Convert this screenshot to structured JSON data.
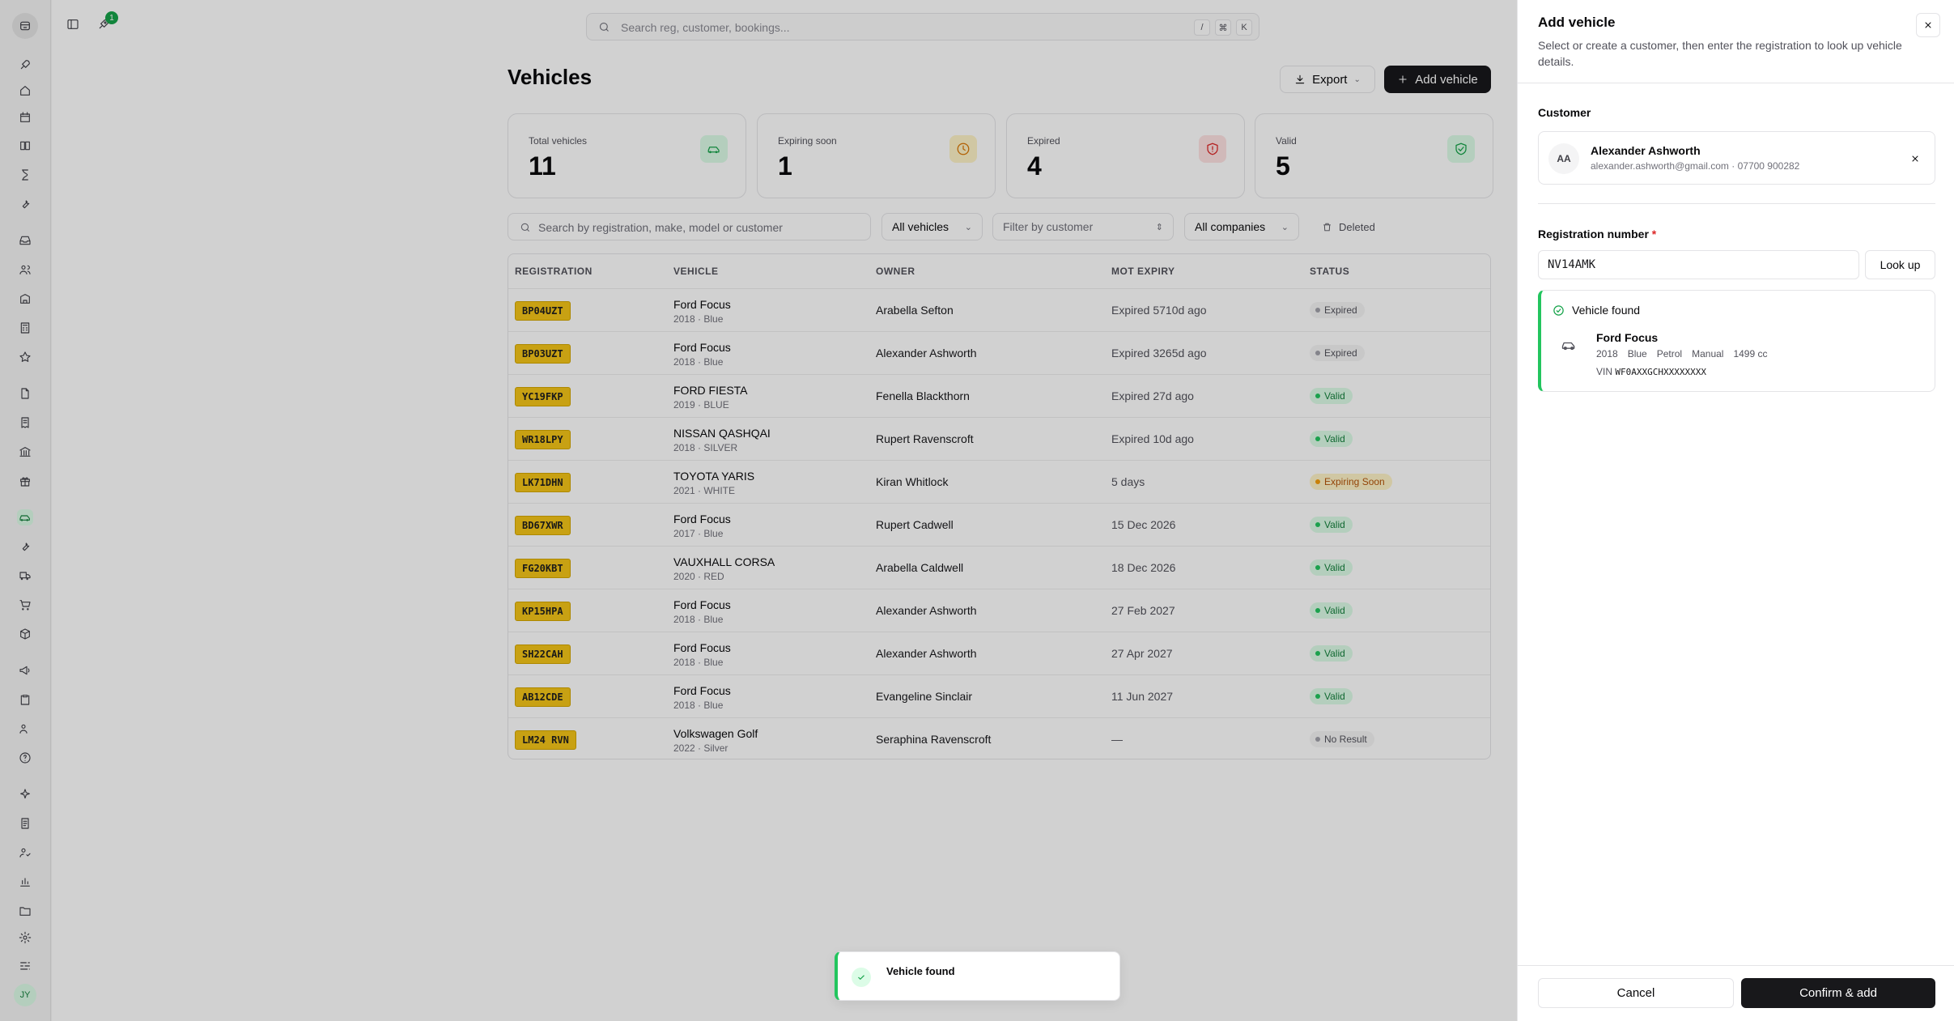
{
  "topbar": {
    "search_placeholder": "Search reg, customer, bookings...",
    "shortcut_keys": [
      "/",
      "⌘",
      "K"
    ],
    "notification_count": "1"
  },
  "page": {
    "title": "Vehicles",
    "export_label": "Export",
    "add_label": "Add vehicle"
  },
  "stats": [
    {
      "label": "Total vehicles",
      "value": "11",
      "color": "#16a34a",
      "bg": "#dcfce7",
      "icon": "car-icon"
    },
    {
      "label": "Expiring soon",
      "value": "1",
      "color": "#d97706",
      "bg": "#fef3c7",
      "icon": "clock-icon"
    },
    {
      "label": "Expired",
      "value": "4",
      "color": "#dc2626",
      "bg": "#fee2e2",
      "icon": "shield-alert-icon"
    },
    {
      "label": "Valid",
      "value": "5",
      "color": "#16a34a",
      "bg": "#dcfce7",
      "icon": "shield-check-icon"
    }
  ],
  "filters": {
    "search_placeholder": "Search by registration, make, model or customer",
    "vehicles_select": "All vehicles",
    "customer_select": "Filter by customer",
    "companies_select": "All companies",
    "deleted_label": "Deleted"
  },
  "table": {
    "headers": [
      "REGISTRATION",
      "VEHICLE",
      "OWNER",
      "MOT EXPIRY",
      "STATUS"
    ],
    "rows": [
      {
        "reg": "BP04UZT",
        "vehicle": "Ford Focus",
        "sub": "2018 · Blue",
        "owner": "Arabella Sefton",
        "mot": "Expired 5710d ago",
        "status": "Expired"
      },
      {
        "reg": "BP03UZT",
        "vehicle": "Ford Focus",
        "sub": "2018 · Blue",
        "owner": "Alexander Ashworth",
        "mot": "Expired 3265d ago",
        "status": "Expired"
      },
      {
        "reg": "YC19FKP",
        "vehicle": "FORD FIESTA",
        "sub": "2019 · BLUE",
        "owner": "Fenella Blackthorn",
        "mot": "Expired 27d ago",
        "status": "Valid"
      },
      {
        "reg": "WR18LPY",
        "vehicle": "NISSAN QASHQAI",
        "sub": "2018 · SILVER",
        "owner": "Rupert Ravenscroft",
        "mot": "Expired 10d ago",
        "status": "Valid"
      },
      {
        "reg": "LK71DHN",
        "vehicle": "TOYOTA YARIS",
        "sub": "2021 · WHITE",
        "owner": "Kiran Whitlock",
        "mot": "5 days",
        "status": "Expiring Soon"
      },
      {
        "reg": "BD67XWR",
        "vehicle": "Ford Focus",
        "sub": "2017 · Blue",
        "owner": "Rupert Cadwell",
        "mot": "15 Dec 2026",
        "status": "Valid"
      },
      {
        "reg": "FG20KBT",
        "vehicle": "VAUXHALL CORSA",
        "sub": "2020 · RED",
        "owner": "Arabella Caldwell",
        "mot": "18 Dec 2026",
        "status": "Valid"
      },
      {
        "reg": "KP15HPA",
        "vehicle": "Ford Focus",
        "sub": "2018 · Blue",
        "owner": "Alexander Ashworth",
        "mot": "27 Feb 2027",
        "status": "Valid"
      },
      {
        "reg": "SH22CAH",
        "vehicle": "Ford Focus",
        "sub": "2018 · Blue",
        "owner": "Alexander Ashworth",
        "mot": "27 Apr 2027",
        "status": "Valid"
      },
      {
        "reg": "AB12CDE",
        "vehicle": "Ford Focus",
        "sub": "2018 · Blue",
        "owner": "Evangeline Sinclair",
        "mot": "11 Jun 2027",
        "status": "Valid"
      },
      {
        "reg": "LM24 RVN",
        "vehicle": "Volkswagen Golf",
        "sub": "2022 · Silver",
        "owner": "Seraphina Ravenscroft",
        "mot": "—",
        "status": "No Result"
      }
    ]
  },
  "status_styles": {
    "Expired": {
      "bg": "#f4f4f5",
      "fg": "#52525b",
      "dot": "#a1a1aa"
    },
    "Valid": {
      "bg": "#dcfce7",
      "fg": "#15803d",
      "dot": "#22c55e"
    },
    "Expiring Soon": {
      "bg": "#fef3c7",
      "fg": "#b45309",
      "dot": "#f59e0b"
    },
    "No Result": {
      "bg": "#f4f4f5",
      "fg": "#52525b",
      "dot": "#a1a1aa"
    }
  },
  "toast": {
    "text": "Vehicle found"
  },
  "drawer": {
    "title": "Add vehicle",
    "subtitle": "Select or create a customer, then enter the registration to look up vehicle details.",
    "customer_label": "Customer",
    "customer": {
      "initials": "AA",
      "name": "Alexander Ashworth",
      "meta": "alexander.ashworth@gmail.com · 07700 900282"
    },
    "reg_label": "Registration number",
    "reg_required": "*",
    "reg_value": "NV14AMK",
    "lookup_label": "Look up",
    "found": {
      "heading": "Vehicle found",
      "name": "Ford Focus",
      "specs": [
        "2018",
        "Blue",
        "Petrol",
        "Manual",
        "1499 cc"
      ],
      "vin_label": "VIN",
      "vin": "WF0AXXGCHXXXXXXXX"
    },
    "cancel_label": "Cancel",
    "confirm_label": "Confirm & add"
  }
}
